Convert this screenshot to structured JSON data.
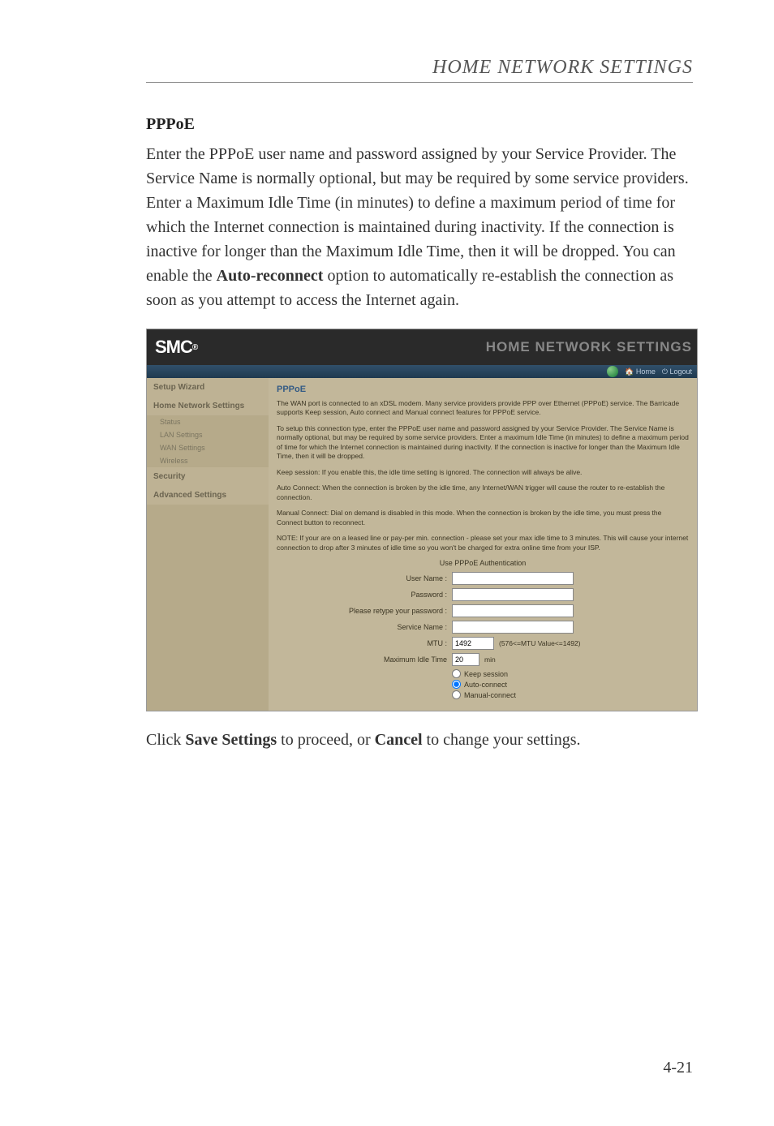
{
  "header": {
    "title": "HOME NETWORK SETTINGS"
  },
  "section": {
    "heading": "PPPoE",
    "paragraph_html": "Enter the PPPoE user name and password assigned by your Service Provider. The Service Name is normally optional, but may be required by some service providers. Enter a Maximum Idle Time (in minutes) to define a maximum period of time for which the Internet connection is maintained during inactivity. If the connection is inactive for longer than the Maximum Idle Time, then it will be dropped. You can enable the <b>Auto-reconnect</b> option to automatically re-establish the connection as soon as you attempt to access the Internet again."
  },
  "screenshot": {
    "logo": "SMC",
    "logo_reg": "®",
    "top_title": "HOME NETWORK SETTINGS",
    "toolbar": {
      "home": "Home",
      "logout": "Logout"
    },
    "sidebar": {
      "setup_wizard": "Setup Wizard",
      "home_network": "Home Network Settings",
      "status": "Status",
      "lan": "LAN Settings",
      "wan": "WAN Settings",
      "wireless": "Wireless",
      "security": "Security",
      "advanced": "Advanced Settings"
    },
    "content": {
      "title": "PPPoE",
      "p1": "The WAN port is connected to an xDSL modem. Many service providers provide PPP over Ethernet (PPPoE) service. The Barricade supports Keep session, Auto connect and Manual connect features for PPPoE service.",
      "p2": "To setup this connection type, enter the PPPoE user name and password assigned by your Service Provider. The Service Name is normally optional, but may be required by some service providers. Enter a maximum Idle Time (in minutes) to define a maximum period of time for which the Internet connection is maintained during inactivity. If the connection is inactive for longer than the Maximum Idle Time, then it will be dropped.",
      "p3": "Keep session: If you enable this, the idle time setting is ignored. The connection will always be alive.",
      "p4": "Auto Connect: When the connection is broken by the idle time, any Internet/WAN trigger will cause the router to re-establish the connection.",
      "p5": "Manual Connect: Dial on demand is disabled in this mode. When the connection is broken by the idle time, you must press the Connect button to reconnect.",
      "p6": "NOTE: If your are on a leased line or pay-per min. connection - please set your max idle time to 3 minutes. This will cause your internet connection to drop after 3 minutes of idle time so you won't be charged for extra online time from your ISP.",
      "form_title": "Use PPPoE Authentication",
      "labels": {
        "username": "User Name :",
        "password": "Password :",
        "retype": "Please retype your password :",
        "service": "Service Name :",
        "mtu": "MTU :",
        "idle": "Maximum Idle Time"
      },
      "values": {
        "mtu": "1492",
        "mtu_hint": "(576<=MTU Value<=1492)",
        "idle": "20",
        "idle_hint": "min"
      },
      "radios": {
        "keep": "Keep session",
        "auto": "Auto-connect",
        "manual": "Manual-connect"
      }
    }
  },
  "caption_html": "Click <b>Save Settings</b> to proceed, or <b>Cancel</b> to change your settings.",
  "page_number": "4-21"
}
